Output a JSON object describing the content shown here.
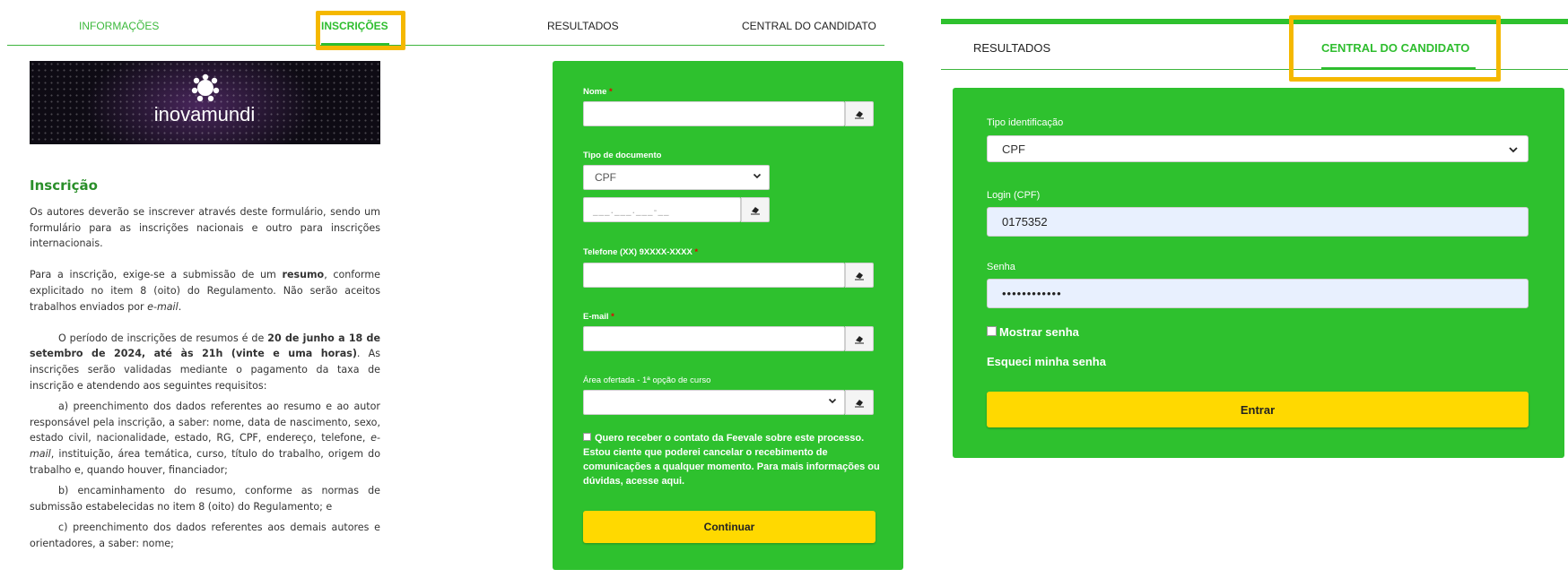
{
  "left_nav": {
    "informacoes": "INFORMAÇÕES",
    "inscricoes": "INSCRIÇÕES",
    "resultados": "RESULTADOS",
    "central": "CENTRAL DO CANDIDATO"
  },
  "banner": {
    "logo_text": "inovamundi"
  },
  "inscricao": {
    "title": "Inscrição",
    "p1": "Os autores deverão se inscrever através deste formulário, sendo um formulário para as inscrições nacionais e outro para inscrições internacionais.",
    "p2_a": "Para a inscrição, exige-se a submissão de um ",
    "p2_bold": "resumo",
    "p2_b": ", conforme explicitado no item 8 (oito) do Regulamento. Não serão aceitos trabalhos enviados por ",
    "p2_em": "e-mail",
    "p2_c": ".",
    "p3_a": "O período de inscrições de resumos é de ",
    "p3_bold": "20 de junho a 18 de setembro de 2024, até às 21h (vinte e uma horas)",
    "p3_b": ". As inscrições serão validadas mediante o pagamento da taxa de inscrição e atendendo aos seguintes requisitos:",
    "item_a_1": "a) preenchimento dos dados referentes ao resumo e ao autor responsável pela inscrição, a saber: nome, data de nascimento, sexo, estado civil, nacionalidade, estado, RG, CPF, endereço, telefone, ",
    "item_a_em": "e-mail",
    "item_a_2": ", instituição, área temática, curso, título do trabalho, origem do trabalho e, quando houver, financiador;",
    "item_b": "b) encaminhamento do resumo, conforme as normas de submissão estabelecidas no item 8 (oito) do Regulamento; e",
    "item_c": "c) preenchimento dos dados referentes aos demais autores e orientadores, a saber: nome;"
  },
  "form": {
    "nome_label": "Nome",
    "required_mark": "*",
    "tipo_doc_label": "Tipo de documento",
    "tipo_doc_value": "CPF",
    "cpf_placeholder": "___.___.___-__",
    "telefone_label": "Telefone (XX) 9XXXX-XXXX",
    "email_label": "E-mail",
    "area_label": "Área ofertada - 1ª opção de curso",
    "consent_text": "Quero receber o contato da Feevale sobre este processo. Estou ciente que poderei cancelar o recebimento de comunicações a qualquer momento. Para mais informações ou dúvidas, acesse aqui.",
    "continue_label": "Continuar"
  },
  "right_nav": {
    "resultados": "RESULTADOS",
    "central": "CENTRAL DO CANDIDATO"
  },
  "login": {
    "tipo_label": "Tipo identificação",
    "tipo_value": "CPF",
    "login_label": "Login (CPF)",
    "login_value": "0175352",
    "senha_label": "Senha",
    "senha_value": "••••••••••••",
    "show_password": "Mostrar senha",
    "forgot": "Esqueci minha senha",
    "enter": "Entrar"
  },
  "colors": {
    "brand_green": "#2ec12e",
    "highlight_yellow": "#f5b800",
    "button_yellow": "#ffd900"
  }
}
